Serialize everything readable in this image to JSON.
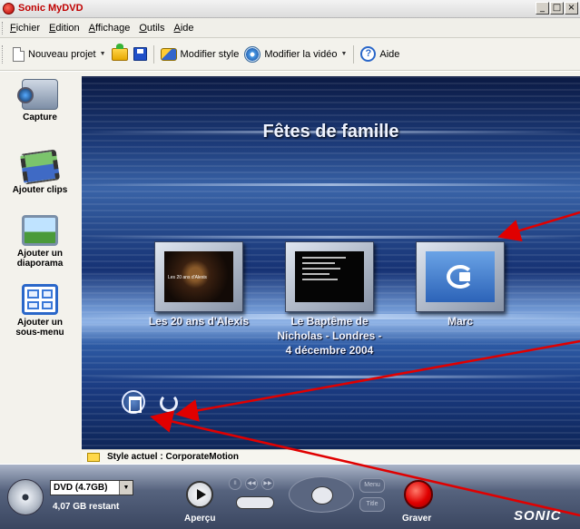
{
  "window": {
    "title": "Sonic MyDVD",
    "controls": [
      "_",
      "□",
      "×"
    ]
  },
  "menubar": {
    "items": [
      "Fichier",
      "Edition",
      "Affichage",
      "Outils",
      "Aide"
    ]
  },
  "toolbar": {
    "new_project": "Nouveau projet",
    "modify_style": "Modifier style",
    "modify_video": "Modifier la vidéo",
    "help": "Aide",
    "icons": [
      "new-document-icon",
      "open-icon",
      "save-icon",
      "style-icon",
      "video-icon",
      "help-icon"
    ]
  },
  "sidebar": {
    "items": [
      {
        "label": "Capture",
        "icon": "camcorder-icon"
      },
      {
        "label": "Ajouter clips",
        "icon": "film-clips-icon"
      },
      {
        "label": "Ajouter un diaporama",
        "icon": "slideshow-icon"
      },
      {
        "label": "Ajouter un sous-menu",
        "icon": "submenu-icon"
      }
    ]
  },
  "preview": {
    "menu_title": "Fêtes de famille",
    "thumb_caption_1": "Les 20 ans d'Alexis",
    "items": [
      {
        "label": "Les 20 ans d'Alexis"
      },
      {
        "label": "Le Baptême de Nicholas - Londres - 4 décembre 2004"
      },
      {
        "label": "Marc"
      }
    ]
  },
  "status": {
    "style_text": "Style actuel : CorporateMotion"
  },
  "bottombar": {
    "disc_select": "DVD (4.7GB)",
    "space_left": "4,07 GB restant",
    "preview_label": "Aperçu",
    "burn_label": "Graver",
    "menu_button": "Menu",
    "title_button": "Title",
    "logo": "SONIC",
    "colors": {
      "burn": "#e00000",
      "bar": "#4a5570"
    }
  }
}
